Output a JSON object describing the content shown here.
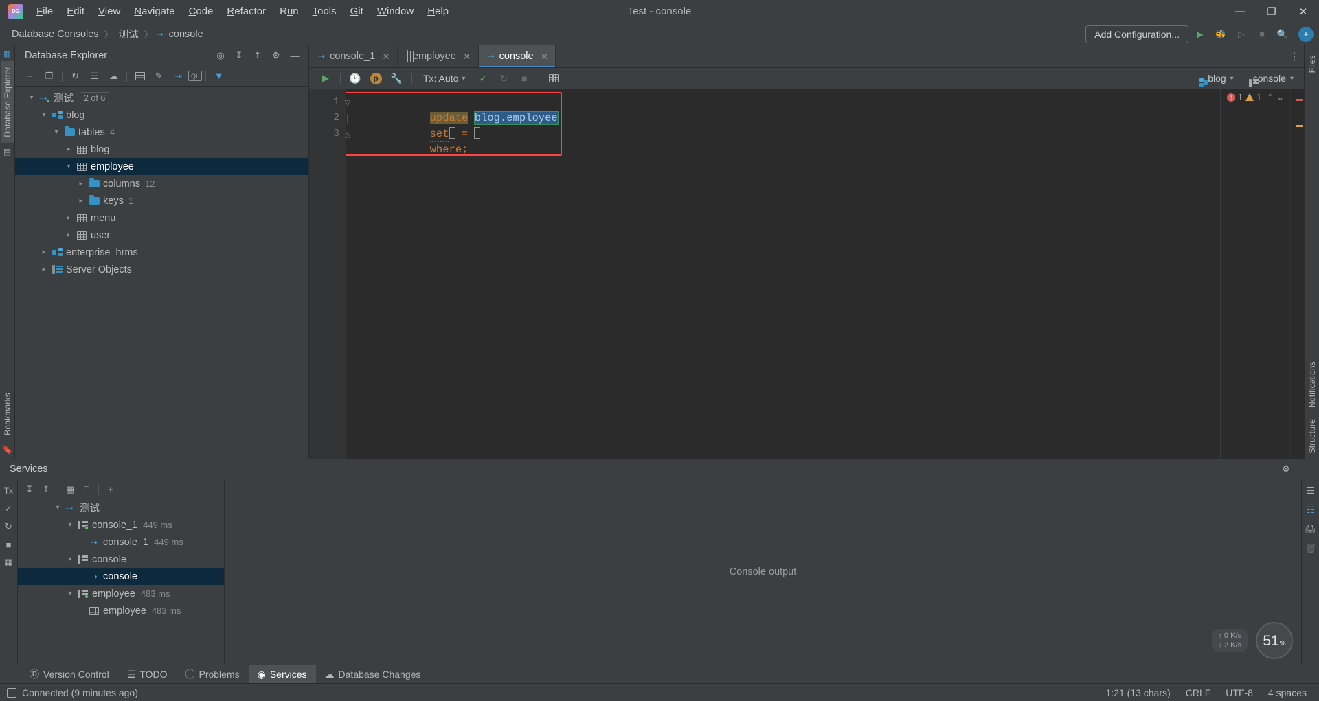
{
  "titlebar": {
    "logo": "datagrip-logo",
    "window_title": "Test - console",
    "menu": [
      "File",
      "Edit",
      "View",
      "Navigate",
      "Code",
      "Refactor",
      "Run",
      "Tools",
      "Git",
      "Window",
      "Help"
    ],
    "minimize": "—",
    "maximize": "❐",
    "close": "✕"
  },
  "navbar": {
    "crumbs": [
      "Database Consoles",
      "测试",
      "console"
    ],
    "separator": "〉",
    "add_configuration": "Add Configuration...",
    "icons": [
      "run-icon",
      "debug-icon",
      "run-with-coverage-icon",
      "stop-icon",
      "search-icon"
    ],
    "account_initial": "●"
  },
  "left_rail": {
    "tabs": [
      "Database Explorer"
    ],
    "bottom_tabs": [
      "Bookmarks"
    ],
    "db_icon": "database-icon"
  },
  "right_rail": {
    "tabs": [
      "Notifications",
      "Structure"
    ],
    "files_label": "Files"
  },
  "explorer": {
    "title": "Database Explorer",
    "header_icons": [
      "locate-icon",
      "expand-all-icon",
      "collapse-all-icon",
      "settings-gear-icon",
      "hide-icon"
    ],
    "toolbar_icons": [
      "add-icon",
      "duplicate-icon",
      "refresh-icon",
      "sync-icon",
      "database-color-icon",
      "table-icon",
      "edit-icon",
      "jump-to-icon",
      "query-console-icon",
      "filter-icon"
    ],
    "tree": [
      {
        "label": "测试",
        "badge": "2 of 6",
        "icon": "connection-icon",
        "depth": 0,
        "expanded": true,
        "selected": false
      },
      {
        "label": "blog",
        "icon": "schema-icon",
        "depth": 1,
        "expanded": true,
        "selected": false
      },
      {
        "label": "tables",
        "count": "4",
        "icon": "folder-icon",
        "depth": 2,
        "expanded": true,
        "selected": false
      },
      {
        "label": "blog",
        "icon": "table-icon",
        "depth": 3,
        "expanded": false,
        "selected": false
      },
      {
        "label": "employee",
        "icon": "table-icon",
        "depth": 3,
        "expanded": true,
        "selected": true
      },
      {
        "label": "columns",
        "count": "12",
        "icon": "folder-icon",
        "depth": 4,
        "expanded": false,
        "selected": false
      },
      {
        "label": "keys",
        "count": "1",
        "icon": "folder-icon",
        "depth": 4,
        "expanded": false,
        "selected": false
      },
      {
        "label": "menu",
        "icon": "table-icon",
        "depth": 3,
        "expanded": false,
        "selected": false
      },
      {
        "label": "user",
        "icon": "table-icon",
        "depth": 3,
        "expanded": false,
        "selected": false
      },
      {
        "label": "enterprise_hrms",
        "icon": "schema-icon",
        "depth": 1,
        "expanded": false,
        "selected": false
      },
      {
        "label": "Server Objects",
        "icon": "server-objects-icon",
        "depth": 1,
        "expanded": false,
        "selected": false
      }
    ]
  },
  "editor": {
    "tabs": [
      {
        "label": "console_1",
        "icon": "console-icon",
        "active": false,
        "close": "✕"
      },
      {
        "label": "employee",
        "icon": "table-icon",
        "active": false,
        "close": "✕"
      },
      {
        "label": "console",
        "icon": "console-icon",
        "active": true,
        "close": "✕"
      }
    ],
    "more_tabs": "⋮",
    "toolbar": {
      "execute": "run-icon",
      "history": "history-clock-icon",
      "params": "p",
      "settings": "wrench-icon",
      "tx_label": "Tx: Auto",
      "commit": "commit-check-icon",
      "rollback": "rollback-icon",
      "stop": "stop-icon",
      "table_view": "table-view-icon",
      "schema_selector": "blog",
      "session_selector": "console",
      "schema_icon": "schema-icon",
      "session_icon": "session-icon"
    },
    "code": {
      "lines": [
        {
          "num": "1",
          "tokens": [
            {
              "text": "update",
              "style": "kw-hl"
            },
            {
              "text": " ",
              "style": "plain"
            },
            {
              "text": "blog.employee",
              "style": "sel-tok"
            }
          ]
        },
        {
          "num": "2",
          "tokens": [
            {
              "text": "set",
              "style": "kw-squig"
            },
            {
              "text": "▐",
              "style": "caret"
            },
            {
              "text": " = ",
              "style": "plain"
            },
            {
              "text": "▐",
              "style": "caret"
            }
          ]
        },
        {
          "num": "3",
          "tokens": [
            {
              "text": "where;",
              "style": "kw"
            }
          ]
        }
      ],
      "raw": "update blog.employee\nset  = \nwhere;"
    },
    "inspections": {
      "errors": "1",
      "warnings": "1",
      "up": "⌃",
      "down": "⌄"
    }
  },
  "services": {
    "title": "Services",
    "header_icons": [
      "settings-gear-icon",
      "hide-icon"
    ],
    "left_toolbar": [
      "tx-icon",
      "commit-check-icon",
      "rollback-icon",
      "stop-icon",
      "layout-icon"
    ],
    "tree_toolbar": [
      "expand-all-icon",
      "collapse-all-icon",
      "group-icon",
      "open-tab-icon",
      "add-icon"
    ],
    "tree": [
      {
        "label": "测试",
        "icon": "connection-icon",
        "depth": 0,
        "expanded": true,
        "selected": false
      },
      {
        "label": "console_1",
        "ms": "449 ms",
        "icon": "session-icon",
        "depth": 1,
        "expanded": true,
        "selected": false
      },
      {
        "label": "console_1",
        "ms": "449 ms",
        "icon": "console-icon",
        "depth": 2,
        "selected": false
      },
      {
        "label": "console",
        "icon": "session-icon",
        "depth": 1,
        "expanded": true,
        "selected": false
      },
      {
        "label": "console",
        "icon": "console-icon",
        "depth": 2,
        "selected": true
      },
      {
        "label": "employee",
        "ms": "483 ms",
        "icon": "session-icon",
        "depth": 1,
        "expanded": true,
        "selected": false
      },
      {
        "label": "employee",
        "ms": "483 ms",
        "icon": "table-icon",
        "depth": 2,
        "selected": false
      }
    ],
    "output_placeholder": "Console output",
    "right_toolbar": [
      "soft-wrap-icon",
      "scroll-end-icon",
      "print-icon",
      "trash-icon"
    ],
    "memory": {
      "up": "↑ 0  K/s",
      "down": "↓ 2  K/s"
    },
    "cpu": {
      "value": "51",
      "unit": "%"
    }
  },
  "toolwindow_bar": {
    "items": [
      {
        "label": "Version Control",
        "icon": "branch-icon",
        "active": false
      },
      {
        "label": "TODO",
        "icon": "list-icon",
        "active": false
      },
      {
        "label": "Problems",
        "icon": "problems-icon",
        "active": false
      },
      {
        "label": "Services",
        "icon": "services-icon",
        "active": true
      },
      {
        "label": "Database Changes",
        "icon": "db-changes-icon",
        "active": false
      }
    ]
  },
  "statusbar": {
    "connection": "Connected (9 minutes ago)",
    "connection_icon": "db-status-icon",
    "caret_position": "1:21 (13 chars)",
    "line_separator": "CRLF",
    "encoding": "UTF-8",
    "indent": "4 spaces"
  },
  "colors": {
    "accent_blue": "#3592c4",
    "selection_blue": "#0d293e",
    "run_green": "#59a869",
    "error_red": "#cf5b56",
    "warn_yellow": "#d9a343",
    "keyword_orange": "#cc7832",
    "highlight_box": "#ff4242"
  }
}
